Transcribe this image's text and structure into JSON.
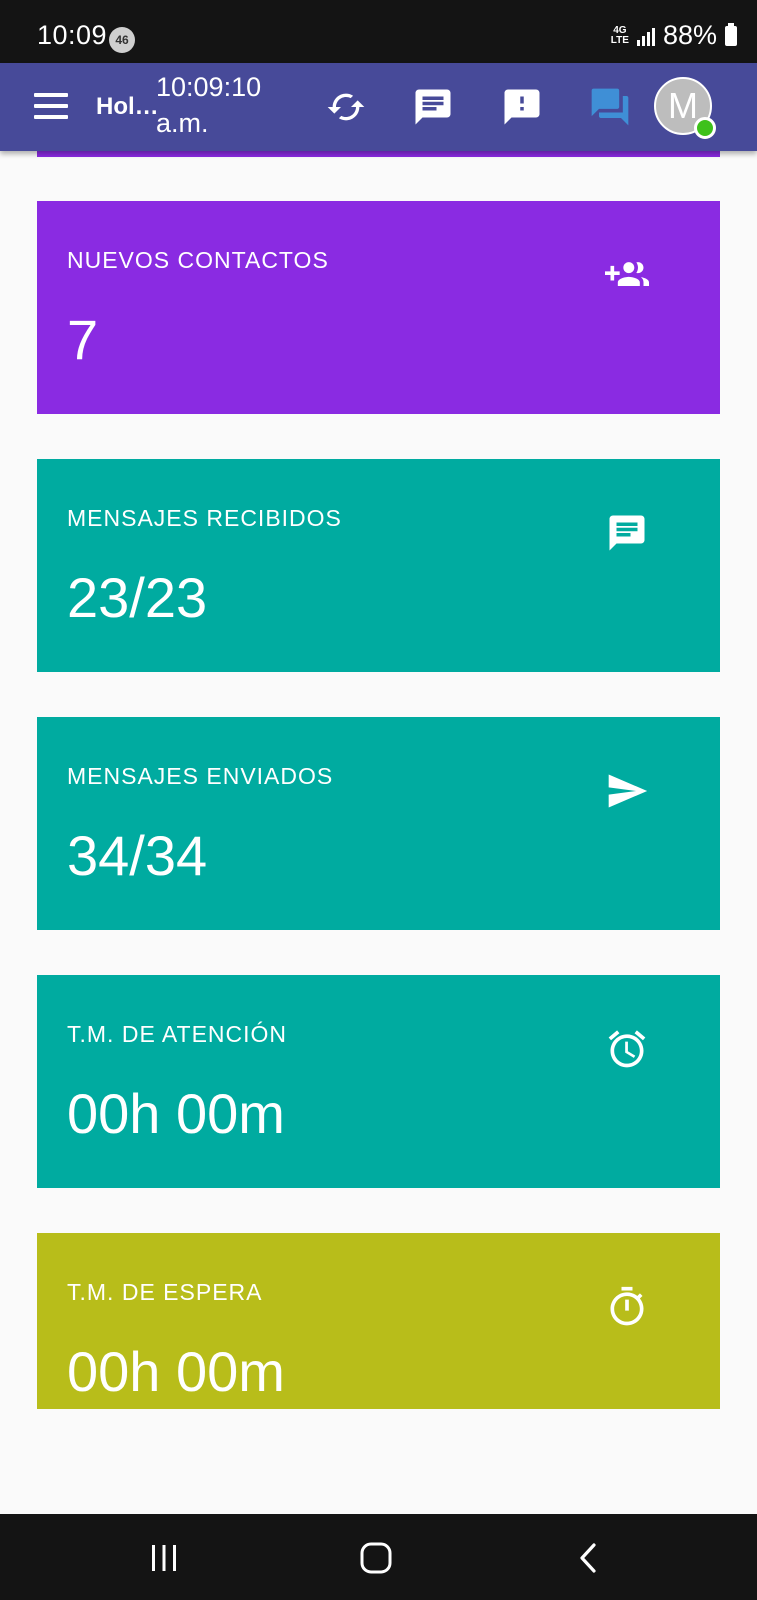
{
  "status_bar": {
    "time": "10:09",
    "badge": "46",
    "network": "4G",
    "network_sub": "LTE",
    "battery": "88%"
  },
  "app_bar": {
    "title": "Hol…",
    "clock_line1": "10:09:10",
    "clock_line2": "a.m.",
    "avatar_initial": "M",
    "icons": [
      "menu-icon",
      "refresh-icon",
      "message-icon",
      "feedback-icon",
      "forum-icon"
    ],
    "colors": {
      "background": "#474a99",
      "forum_icon": "#3f8fd6",
      "online_dot": "#3ec11b"
    }
  },
  "cards": [
    {
      "label": "NUEVOS CONTACTOS",
      "value": "7",
      "icon": "group-add-icon",
      "color": "#8a2be2"
    },
    {
      "label": "MENSAJES RECIBIDOS",
      "value": "23/23",
      "icon": "message-icon",
      "color": "#00aba0"
    },
    {
      "label": "MENSAJES ENVIADOS",
      "value": "34/34",
      "icon": "send-icon",
      "color": "#00aba0"
    },
    {
      "label": "T.M. DE ATENCIÓN",
      "value": "00h 00m",
      "icon": "alarm-icon",
      "color": "#00aba0"
    },
    {
      "label": "T.M. DE ESPERA",
      "value": "00h 00m",
      "icon": "timer-icon",
      "color": "#b8bd1a"
    }
  ],
  "nav_bar": {
    "buttons": [
      "recent-apps-icon",
      "home-icon",
      "back-icon"
    ]
  }
}
